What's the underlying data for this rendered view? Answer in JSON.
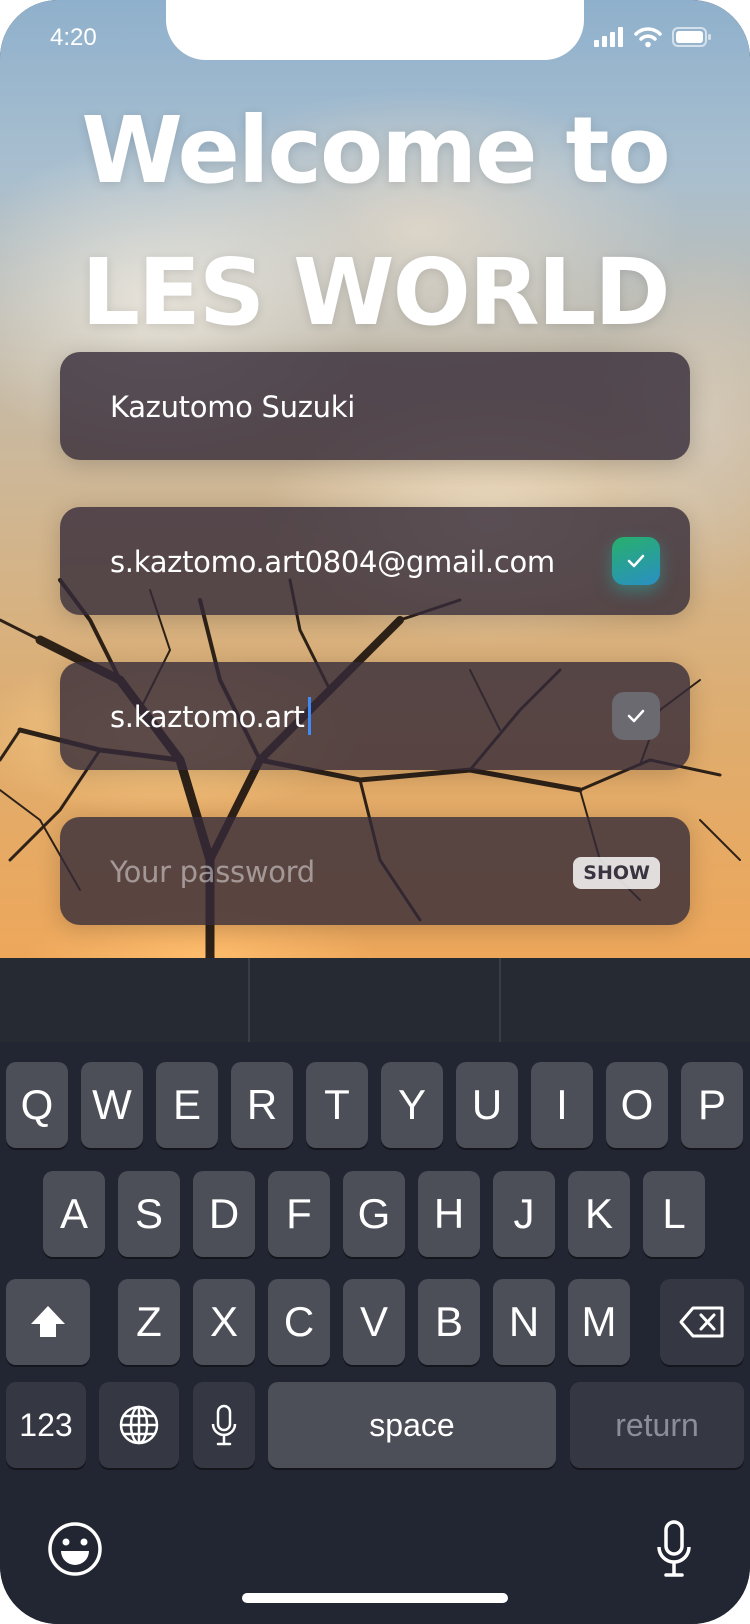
{
  "status_bar": {
    "time": "4:20",
    "icons": [
      "signal-icon",
      "wifi-icon",
      "battery-icon"
    ]
  },
  "welcome": {
    "line1": "Welcome to",
    "line2": "LES WORLD"
  },
  "form": {
    "name_value": "Kazutomo Suzuki",
    "email_value": "s.kaztomo.art0804@gmail.com",
    "username_value": "s.kaztomo.art",
    "password_placeholder": "Your password",
    "show_label": "SHOW"
  },
  "keyboard": {
    "row1": [
      "Q",
      "W",
      "E",
      "R",
      "T",
      "Y",
      "U",
      "I",
      "O",
      "P"
    ],
    "row2": [
      "A",
      "S",
      "D",
      "F",
      "G",
      "H",
      "J",
      "K",
      "L"
    ],
    "row3": [
      "Z",
      "X",
      "C",
      "V",
      "B",
      "N",
      "M"
    ],
    "numbers_label": "123",
    "space_label": "space",
    "return_label": "return"
  },
  "colors": {
    "accent": "#3f8af5",
    "check_green": "#27b06b",
    "check_blue": "#2a8fc4",
    "keyboard_bg": "#222532",
    "key_bg": "#4c4f57"
  }
}
